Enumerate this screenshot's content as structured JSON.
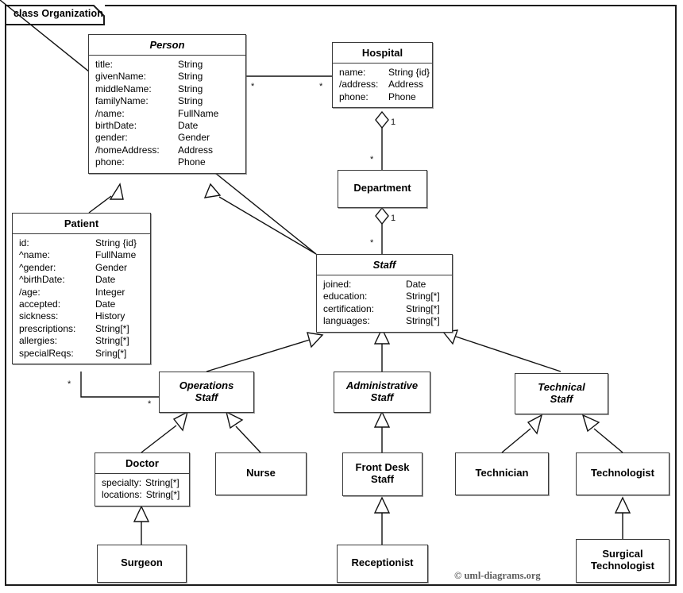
{
  "frame": {
    "tab_label": "class Organization",
    "copyright": "© uml-diagrams.org"
  },
  "classes": {
    "person": {
      "name": "Person",
      "abstract": true,
      "attributes": [
        {
          "name": "title:",
          "type": "String"
        },
        {
          "name": "givenName:",
          "type": "String"
        },
        {
          "name": "middleName:",
          "type": "String"
        },
        {
          "name": "familyName:",
          "type": "String"
        },
        {
          "name": "/name:",
          "type": "FullName"
        },
        {
          "name": "birthDate:",
          "type": "Date"
        },
        {
          "name": "gender:",
          "type": "Gender"
        },
        {
          "name": "/homeAddress:",
          "type": "Address"
        },
        {
          "name": "phone:",
          "type": "Phone"
        }
      ]
    },
    "hospital": {
      "name": "Hospital",
      "abstract": false,
      "attributes": [
        {
          "name": "name:",
          "type": "String {id}"
        },
        {
          "name": "/address:",
          "type": "Address"
        },
        {
          "name": "phone:",
          "type": "Phone"
        }
      ]
    },
    "department": {
      "name": "Department",
      "abstract": false,
      "attributes": []
    },
    "patient": {
      "name": "Patient",
      "abstract": false,
      "attributes": [
        {
          "name": "id:",
          "type": "String {id}"
        },
        {
          "name": "^name:",
          "type": "FullName"
        },
        {
          "name": "^gender:",
          "type": "Gender"
        },
        {
          "name": "^birthDate:",
          "type": "Date"
        },
        {
          "name": "/age:",
          "type": "Integer"
        },
        {
          "name": "accepted:",
          "type": "Date"
        },
        {
          "name": "sickness:",
          "type": "History"
        },
        {
          "name": "prescriptions:",
          "type": "String[*]"
        },
        {
          "name": "allergies:",
          "type": "String[*]"
        },
        {
          "name": "specialReqs:",
          "type": "Sring[*]"
        }
      ]
    },
    "staff": {
      "name": "Staff",
      "abstract": true,
      "attributes": [
        {
          "name": "joined:",
          "type": "Date"
        },
        {
          "name": "education:",
          "type": "String[*]"
        },
        {
          "name": "certification:",
          "type": "String[*]"
        },
        {
          "name": "languages:",
          "type": "String[*]"
        }
      ]
    },
    "operations_staff": {
      "name": "Operations\nStaff",
      "abstract": true,
      "attributes": []
    },
    "administrative_staff": {
      "name": "Administrative\nStaff",
      "abstract": true,
      "attributes": []
    },
    "technical_staff": {
      "name": "Technical\nStaff",
      "abstract": true,
      "attributes": []
    },
    "doctor": {
      "name": "Doctor",
      "abstract": false,
      "attributes": [
        {
          "name": "specialty:",
          "type": "String[*]"
        },
        {
          "name": "locations:",
          "type": "String[*]"
        }
      ]
    },
    "nurse": {
      "name": "Nurse",
      "abstract": false,
      "attributes": []
    },
    "front_desk_staff": {
      "name": "Front Desk\nStaff",
      "abstract": false,
      "attributes": []
    },
    "technician": {
      "name": "Technician",
      "abstract": false,
      "attributes": []
    },
    "technologist": {
      "name": "Technologist",
      "abstract": false,
      "attributes": []
    },
    "surgeon": {
      "name": "Surgeon",
      "abstract": false,
      "attributes": []
    },
    "receptionist": {
      "name": "Receptionist",
      "abstract": false,
      "attributes": []
    },
    "surgical_technologist": {
      "name": "Surgical\nTechnologist",
      "abstract": false,
      "attributes": []
    }
  },
  "relationships": {
    "person_hospital": {
      "kind": "association",
      "source": "Person",
      "target": "Hospital",
      "source_multiplicity": "*",
      "target_multiplicity": "*"
    },
    "hospital_department": {
      "kind": "aggregation",
      "source": "Hospital",
      "target": "Department",
      "source_multiplicity": "1",
      "target_multiplicity": "*"
    },
    "department_staff": {
      "kind": "aggregation",
      "source": "Department",
      "target": "Staff",
      "source_multiplicity": "1",
      "target_multiplicity": "*"
    },
    "patient_operations_staff": {
      "kind": "association",
      "source": "Patient",
      "target": "Operations Staff",
      "source_multiplicity": "*",
      "target_multiplicity": "*"
    },
    "generalizations": [
      {
        "child": "Patient",
        "parent": "Person"
      },
      {
        "child": "Staff",
        "parent": "Person"
      },
      {
        "child": "Operations Staff",
        "parent": "Staff"
      },
      {
        "child": "Administrative Staff",
        "parent": "Staff"
      },
      {
        "child": "Technical Staff",
        "parent": "Staff"
      },
      {
        "child": "Doctor",
        "parent": "Operations Staff"
      },
      {
        "child": "Nurse",
        "parent": "Operations Staff"
      },
      {
        "child": "Front Desk Staff",
        "parent": "Administrative Staff"
      },
      {
        "child": "Technician",
        "parent": "Technical Staff"
      },
      {
        "child": "Technologist",
        "parent": "Technical Staff"
      },
      {
        "child": "Surgeon",
        "parent": "Doctor"
      },
      {
        "child": "Receptionist",
        "parent": "Front Desk Staff"
      },
      {
        "child": "Surgical Technologist",
        "parent": "Technologist"
      }
    ]
  },
  "multiplicity_labels": {
    "person_end": "*",
    "hospital_end": "*",
    "hospital_dept_one": "1",
    "dept_many": "*",
    "dept_staff_one": "1",
    "staff_many": "*",
    "patient_end": "*",
    "ops_end": "*"
  }
}
